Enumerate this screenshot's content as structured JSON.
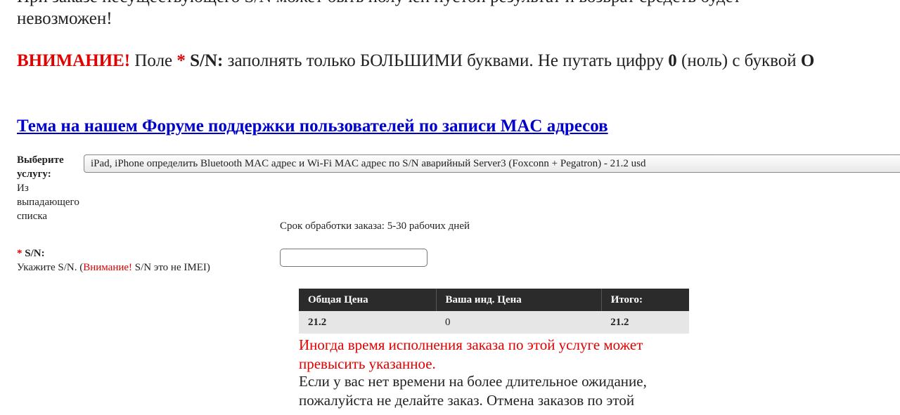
{
  "intro": {
    "line1": "При заказе несуществующего S/N может быть получен пустой результат и возврат средств будет",
    "line2": "невозможен!"
  },
  "warning": {
    "title": "ВНИМАНИЕ!",
    "field_prefix": "Поле",
    "star": "*",
    "field_name": "S/N:",
    "text1": "заполнять только БОЛЬШИМИ буквами. Не путать цифру",
    "zero": "0",
    "text2": "(ноль) с буквой",
    "letter_o": "O"
  },
  "forum_link": "Тема на нашем Форуме поддержки пользователей по записи MAC адресов",
  "service": {
    "label": "Выберите услугу:",
    "hint": "Из выпадающего списка",
    "selected": "iPad, iPhone определить Bluetooth MAC адрес и Wi-Fi MAC адрес по S/N аварийный Server3 (Foxconn + Pegatron) - 21.2 usd"
  },
  "processing_time": "Срок обработки заказа: 5-30 рабочих дней",
  "sn_field": {
    "star": "*",
    "label": "S/N:",
    "hint_prefix": "Укажите S/N. (",
    "hint_attention": "Внимание!",
    "hint_suffix": " S/N это не IMEI)",
    "value": ""
  },
  "price_table": {
    "headers": [
      "Общая Цена",
      "Ваша инд. Цена",
      "Итого:"
    ],
    "row": [
      "21.2",
      "0",
      "21.2"
    ]
  },
  "notes": {
    "red": "Иногда время исполнения заказа по этой услуге может превысить указанное.",
    "black": "Если у вас нет времени на более длительное ожидание, пожалуйста не делайте заказ. Отмена заказов по этой"
  },
  "colors": {
    "accent_red": "#e00000",
    "link_blue": "#0000cc",
    "table_header": "#2b2b2b",
    "table_row": "#e6e6e6"
  }
}
